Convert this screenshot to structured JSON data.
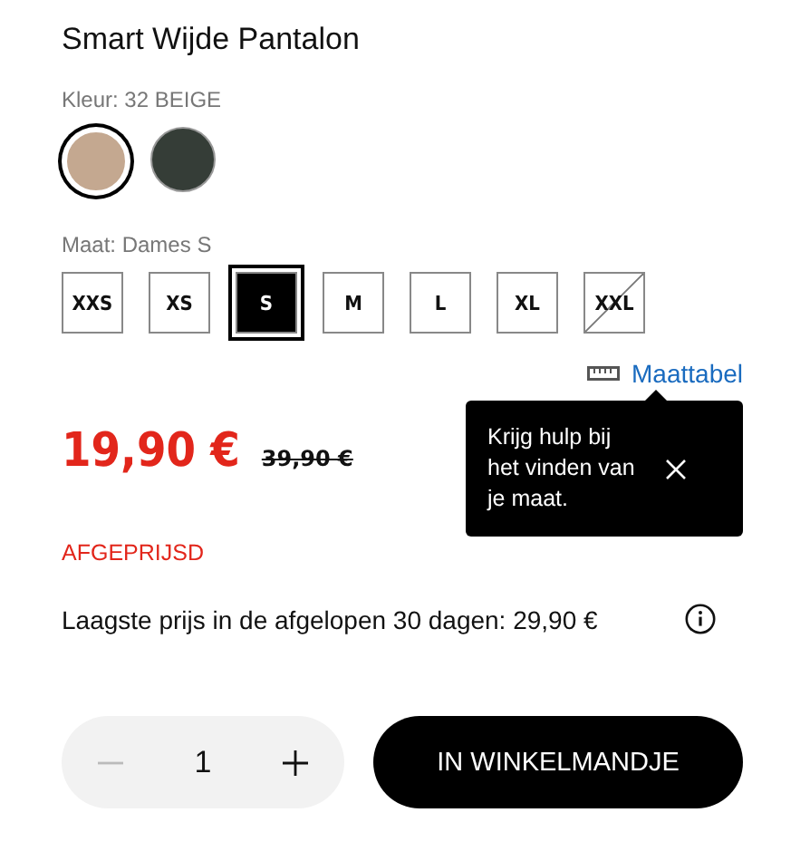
{
  "title": "Smart Wijde Pantalon",
  "color_label": "Kleur: 32 BEIGE",
  "swatches": [
    {
      "color": "#c4a890",
      "selected": true
    },
    {
      "color": "#353d37",
      "selected": false
    }
  ],
  "size_label": "Maat: Dames S",
  "sizes": [
    {
      "label": "XXS",
      "selected": false,
      "disabled": false
    },
    {
      "label": "XS",
      "selected": false,
      "disabled": false
    },
    {
      "label": "S",
      "selected": true,
      "disabled": false
    },
    {
      "label": "M",
      "selected": false,
      "disabled": false
    },
    {
      "label": "L",
      "selected": false,
      "disabled": false
    },
    {
      "label": "XL",
      "selected": false,
      "disabled": false
    },
    {
      "label": "XXL",
      "selected": false,
      "disabled": true
    }
  ],
  "size_chart_link": "Maattabel",
  "tooltip": {
    "text": "Krijg hulp bij het vinden van je maat."
  },
  "price": "19,90 €",
  "old_price": "39,90 €",
  "sale_badge": "AFGEPRIJSD",
  "lowest_price_note": "Laagste prijs in de afgelopen 30 dagen: 29,90 €",
  "quantity": "1",
  "cart_button": "IN WINKELMANDJE"
}
